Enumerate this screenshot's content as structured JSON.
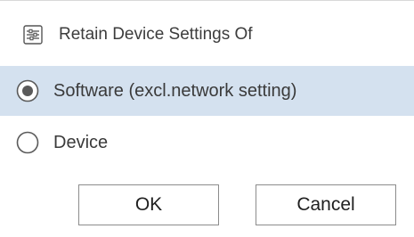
{
  "dialog": {
    "title": "Retain Device Settings Of",
    "title_icon": "settings-sliders-icon"
  },
  "options": [
    {
      "label": "Software (excl.network setting)",
      "selected": true
    },
    {
      "label": "Device",
      "selected": false
    }
  ],
  "buttons": {
    "ok_label": "OK",
    "cancel_label": "Cancel"
  },
  "colors": {
    "selected_row": "#d4e1ef",
    "radio_ring": "#5a5a5a",
    "radio_dot": "#5a5a5a"
  }
}
